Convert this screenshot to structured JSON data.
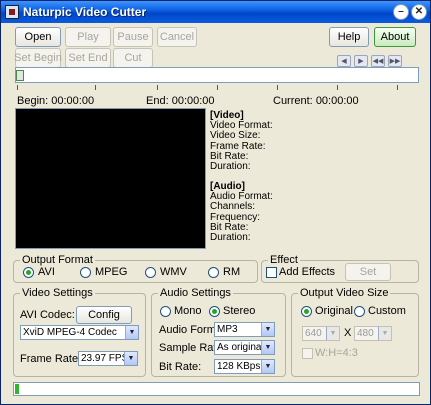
{
  "window": {
    "title": "Naturpic Video Cutter"
  },
  "toolbar": {
    "open": "Open",
    "play": "Play",
    "pause": "Pause",
    "cancel": "Cancel",
    "set_begin": "Set Begin",
    "set_end": "Set End",
    "cut": "Cut",
    "help": "Help",
    "about": "About"
  },
  "nav_icons": [
    "prev-frame-icon",
    "next-frame-icon",
    "rewind-icon",
    "fast-forward-icon"
  ],
  "timeline": {
    "begin_label": "Begin:",
    "begin_value": "00:00:00",
    "end_label": "End:",
    "end_value": "00:00:00",
    "current_label": "Current:",
    "current_value": "00:00:00",
    "position": 0
  },
  "info": {
    "video_header": "[Video]",
    "video_fields": [
      "Video Format:",
      "Video Size:",
      "Frame Rate:",
      "Bit Rate:",
      "Duration:"
    ],
    "audio_header": "[Audio]",
    "audio_fields": [
      "Audio Format:",
      "Channels:",
      "Frequency:",
      "Bit Rate:",
      "Duration:"
    ]
  },
  "output_format": {
    "legend": "Output Format",
    "options": [
      "AVI",
      "MPEG",
      "WMV",
      "RM"
    ],
    "selected": "AVI"
  },
  "effect": {
    "legend": "Effect",
    "add_label": "Add Effects",
    "set_label": "Set",
    "checked": false
  },
  "video_settings": {
    "legend": "Video Settings",
    "codec_label": "AVI Codec:",
    "config_label": "Config",
    "codec_value": "XviD MPEG-4 Codec",
    "frame_rate_label": "Frame Rate:",
    "frame_rate_value": "23.97 FPS"
  },
  "audio_settings": {
    "legend": "Audio Settings",
    "mono": "Mono",
    "stereo": "Stereo",
    "selected": "Stereo",
    "format_label": "Audio Format:",
    "format_value": "MP3",
    "sample_label": "Sample Rate:",
    "sample_value": "As original",
    "bitrate_label": "Bit Rate:",
    "bitrate_value": "128 KBps"
  },
  "output_size": {
    "legend": "Output Video Size",
    "original": "Original",
    "custom": "Custom",
    "selected": "Original",
    "width": "640",
    "x_sep": "X",
    "height": "480",
    "ratio_label": "W:H=4:3"
  },
  "progress": {
    "value": 0.01
  },
  "colors": {
    "titlebar": "#0a5ce0",
    "progress": "#34b234",
    "window_bg": "#ece9d8"
  }
}
